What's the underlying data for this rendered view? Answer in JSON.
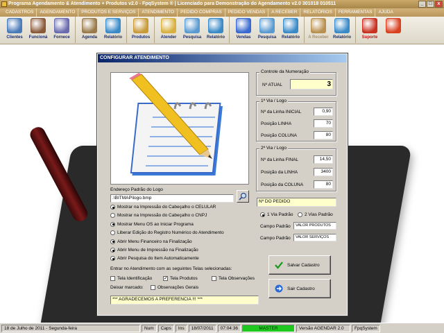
{
  "window": {
    "title": "Programa Agendamento & Atendimento + Produtos v2.0 - FpqSystem ® | Licenciado para  Demonstração do Agendamento v2.0 301018 010511",
    "controls": [
      "_",
      "□",
      "x"
    ]
  },
  "menubar": [
    "CADASTROS",
    "AGENDAMENTO",
    "PRODUTOS E SERVIÇOS",
    "ATENDIMENTO",
    "PEDIDO COMPRAS",
    "PEDIDO VENDAS",
    "A RECEBER",
    "RELATÓRIOS",
    "FERRAMENTAS",
    "AJUDA"
  ],
  "toolbar": [
    {
      "label": "Clientes",
      "icon": "clients-icon",
      "color": "#4a7ab8"
    },
    {
      "label": "Funcioná",
      "icon": "employee-icon",
      "color": "#8a5a3a"
    },
    {
      "label": "Fornece",
      "icon": "supplier-icon",
      "color": "#6a6ab0"
    },
    {
      "label": "Agenda",
      "icon": "clock-icon",
      "color": "#9a7a4a"
    },
    {
      "label": "Relatório",
      "icon": "report-icon",
      "color": "#3a8ac8"
    },
    {
      "label": "Produtos",
      "icon": "boxes-icon",
      "color": "#c89a3a"
    },
    {
      "label": "Atender",
      "icon": "pen-paper-icon",
      "color": "#d8b040"
    },
    {
      "label": "Pesquisa",
      "icon": "search-doc-icon",
      "color": "#5a9ad0"
    },
    {
      "label": "Relatório",
      "icon": "report-icon",
      "color": "#3a8ac8"
    },
    {
      "label": "Vendas",
      "icon": "monitor-icon",
      "color": "#3a6ad0"
    },
    {
      "label": "Pesquisa",
      "icon": "search-doc-icon",
      "color": "#5a9ad0"
    },
    {
      "label": "Relatório",
      "icon": "report-icon",
      "color": "#3a8ac8"
    },
    {
      "label": "A Receber",
      "icon": "money-icon",
      "color": "#b89050"
    },
    {
      "label": "Relatório",
      "icon": "report-icon",
      "color": "#3a8ac8"
    },
    {
      "label": "Suporte",
      "icon": "support-icon",
      "color": "#c83020"
    },
    {
      "label": "",
      "icon": "exit-icon",
      "color": "#d84020"
    }
  ],
  "dialog": {
    "title": "CONFIGURAR ATENDIMENTO",
    "numeracao": {
      "title": "Controle da Numeração",
      "label": "Nº ATUAL",
      "value": "3"
    },
    "via1": {
      "title": "1ª Via / Logo",
      "rows": [
        {
          "label": "Nº da Linha INICIAL",
          "value": "0,90"
        },
        {
          "label": "Posição LINHA",
          "value": "70"
        },
        {
          "label": "Posição COLUNA",
          "value": "80"
        }
      ]
    },
    "via2": {
      "title": "2ª Via / Logo",
      "rows": [
        {
          "label": "Nº da Linha FINAL",
          "value": "14,50"
        },
        {
          "label": "Posição da LINHA",
          "value": "3400"
        },
        {
          "label": "Posição da COLUNA",
          "value": "80"
        }
      ]
    },
    "logo_path_label": "Endereço Padrão do Logo",
    "logo_path": ".\\BITMAP\\logo.bmp",
    "options": [
      {
        "label": "Mostrar na Impressão do Cabeçalho o CELULAR",
        "on": true
      },
      {
        "label": "Mostrar na Impressão do Cabeçalho o CNPJ",
        "on": false
      },
      {
        "label": "Mostrar Menu OS ao Iniciar Programa",
        "on": true
      },
      {
        "label": "Liberar Edição do Registro Numérico do Atendimento",
        "on": false
      },
      {
        "label": "Abrir Menu Financeiro na Finalização",
        "on": true
      },
      {
        "label": "Abrir Menu de Impressão na Finalização",
        "on": true
      },
      {
        "label": "Abrir Pesquisa do Item Automaticamente",
        "on": true
      }
    ],
    "telas_label": "Entrar no Atendimento com as seguintes Telas selecionadas:",
    "telas": [
      {
        "label": "Tela Identificação",
        "checked": false
      },
      {
        "label": "Tela Produtos",
        "checked": true
      },
      {
        "label": "Tela Observações",
        "checked": false
      }
    ],
    "deixar_label": "Deixar marcado:",
    "obs_gerais": {
      "label": "Observações Gerais",
      "checked": false
    },
    "footer_message": "*** AGRADECEMOS A PREFERENCIA !!! ***",
    "pedido_label": "Nº DO PEDIDO",
    "via_options": [
      {
        "label": "1 Via Padrão",
        "on": true
      },
      {
        "label": "2 Vias Padrão",
        "on": false
      }
    ],
    "campo1": {
      "label": "Campo Padrão",
      "value": "VALOR PRODUTOS"
    },
    "campo2": {
      "label": "Campo Padrão",
      "value": "VALOR SERVIÇOS"
    },
    "save_label": "Salvar Cadastro",
    "exit_label": "Sair Cadastro"
  },
  "statusbar": {
    "date": "18 de Julho de 2011 - Segunda-feira",
    "num": "Num",
    "caps": "Caps",
    "ins": "Ins",
    "short_date": "18/07/2011",
    "time": "07:04:36",
    "mode": "MASTER",
    "version": "Versão AGENDAR 2.0",
    "company": "FpqSystem"
  }
}
